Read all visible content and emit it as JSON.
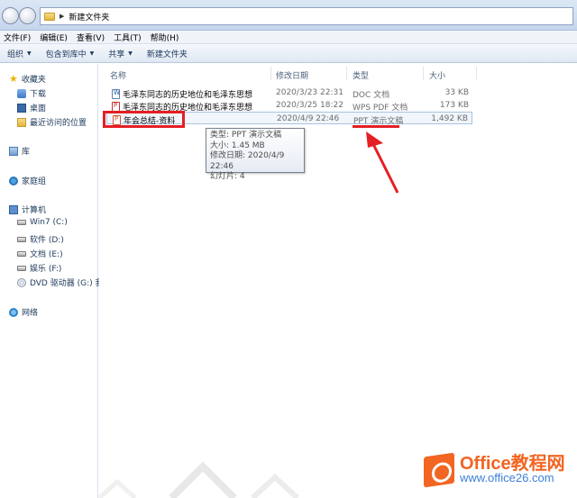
{
  "address": {
    "path": "新建文件夹"
  },
  "menu": [
    "文件(F)",
    "编辑(E)",
    "查看(V)",
    "工具(T)",
    "帮助(H)"
  ],
  "toolbar": {
    "organize": "组织",
    "include": "包含到库中",
    "share": "共享",
    "new_folder": "新建文件夹"
  },
  "sidebar": {
    "favorites": "收藏夹",
    "downloads": "下载",
    "desktop": "桌面",
    "recent": "最近访问的位置",
    "library": "库",
    "homegroup": "家庭组",
    "computer": "计算机",
    "drive_c": "Win7 (C:)",
    "drive_d": "软件 (D:)",
    "drive_e": "文档 (E:)",
    "drive_f": "娱乐 (F:)",
    "drive_g": "DVD 驱动器 (G:) 我",
    "network": "网络"
  },
  "columns": {
    "name": "名称",
    "modified": "修改日期",
    "type": "类型",
    "size": "大小"
  },
  "files": [
    {
      "name": "毛泽东同志的历史地位和毛泽东思想",
      "modified": "2020/3/23 22:31",
      "type": "DOC 文档",
      "size": "33 KB",
      "icon": "word-doc-icon"
    },
    {
      "name": "毛泽东同志的历史地位和毛泽东思想",
      "modified": "2020/3/25 18:22",
      "type": "WPS PDF 文档",
      "size": "173 KB",
      "icon": "pdf-icon"
    },
    {
      "name": "年会总结-资料",
      "modified": "2020/4/9 22:46",
      "type": "PPT 演示文稿",
      "size": "1,492 KB",
      "icon": "ppt-icon"
    }
  ],
  "tooltip": {
    "type": "类型: PPT 演示文稿",
    "size": "大小: 1.45 MB",
    "modified": "修改日期: 2020/4/9 22:46",
    "slides": "幻灯片: 4"
  },
  "watermark": {
    "brand": "Office教程网",
    "url": "www.office26.com"
  },
  "colors": {
    "highlight": "#e41f24",
    "brand_orange": "#f26522",
    "brand_blue": "#3d7fd6"
  }
}
